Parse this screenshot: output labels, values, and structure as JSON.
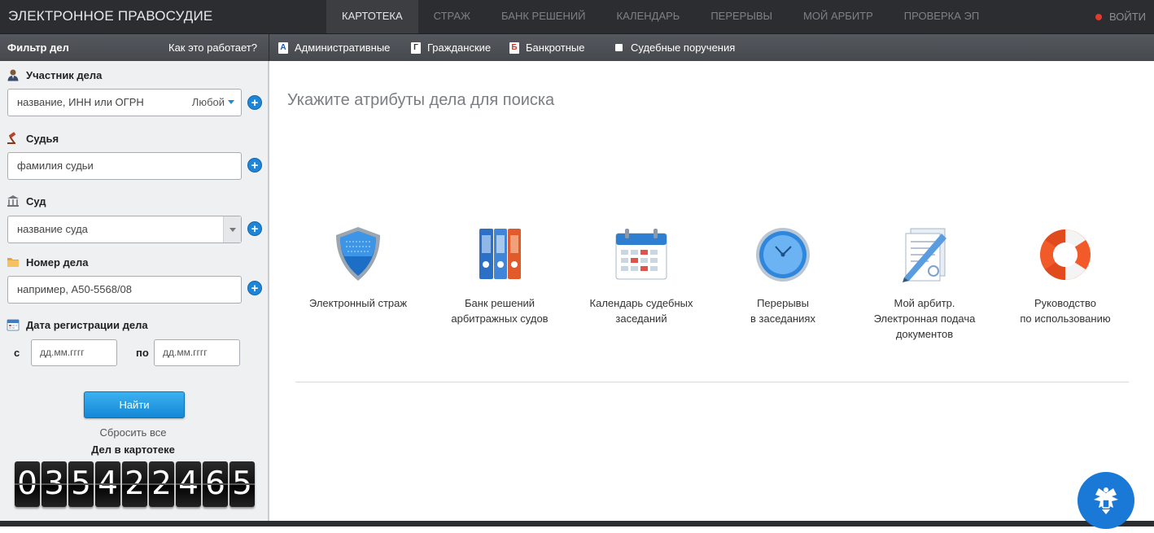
{
  "header": {
    "brand": "ЭЛЕКТРОННОЕ ПРАВОСУДИЕ",
    "nav": [
      "КАРТОТЕКА",
      "СТРАЖ",
      "БАНК РЕШЕНИЙ",
      "КАЛЕНДАРЬ",
      "ПЕРЕРЫВЫ",
      "МОЙ АРБИТР",
      "ПРОВЕРКА ЭП"
    ],
    "active_nav": "КАРТОТЕКА",
    "login": "ВОЙТИ"
  },
  "subbar": {
    "filter_title": "Фильтр дел",
    "how_it_works": "Как это работает?",
    "case_types": [
      {
        "letter": "А",
        "label": "Административные"
      },
      {
        "letter": "Г",
        "label": "Гражданские"
      },
      {
        "letter": "Б",
        "label": "Банкротные"
      },
      {
        "letter": "",
        "label": "Судебные поручения"
      }
    ]
  },
  "sidebar": {
    "participant": {
      "label": "Участник дела",
      "placeholder": "название, ИНН или ОГРН",
      "role": "Любой"
    },
    "judge": {
      "label": "Судья",
      "placeholder": "фамилия судьи"
    },
    "court": {
      "label": "Суд",
      "placeholder": "название суда"
    },
    "case_number": {
      "label": "Номер дела",
      "placeholder": "например, А50-5568/08"
    },
    "reg_date": {
      "label": "Дата регистрации дела",
      "from_label": "с",
      "to_label": "по",
      "from_placeholder": "дд.мм.гггг",
      "to_placeholder": "дд.мм.гггг"
    },
    "find_button": "Найти",
    "reset": "Сбросить все",
    "count_title": "Дел в картотеке",
    "count_digits": [
      "0",
      "3",
      "5",
      "4",
      "2",
      "2",
      "4",
      "6",
      "5"
    ]
  },
  "main": {
    "title": "Укажите атрибуты дела для поиска",
    "services": [
      {
        "line1": "Электронный страж",
        "line2": "",
        "line3": "",
        "icon": "shield-icon"
      },
      {
        "line1": "Банк решений",
        "line2": "арбитражных судов",
        "line3": "",
        "icon": "binders-icon"
      },
      {
        "line1": "Календарь судебных",
        "line2": "заседаний",
        "line3": "",
        "icon": "calendar-icon"
      },
      {
        "line1": "Перерывы",
        "line2": "в заседаниях",
        "line3": "",
        "icon": "clock-icon"
      },
      {
        "line1": "Мой арбитр.",
        "line2": "Электронная подача",
        "line3": "документов",
        "icon": "document-pen-icon"
      },
      {
        "line1": "Руководство",
        "line2": "по использованию",
        "line3": "",
        "icon": "lifebuoy-icon"
      }
    ]
  },
  "colors": {
    "accent": "#1d86d8",
    "topbar": "#2b2d30",
    "login_dot": "#e23b2e"
  }
}
